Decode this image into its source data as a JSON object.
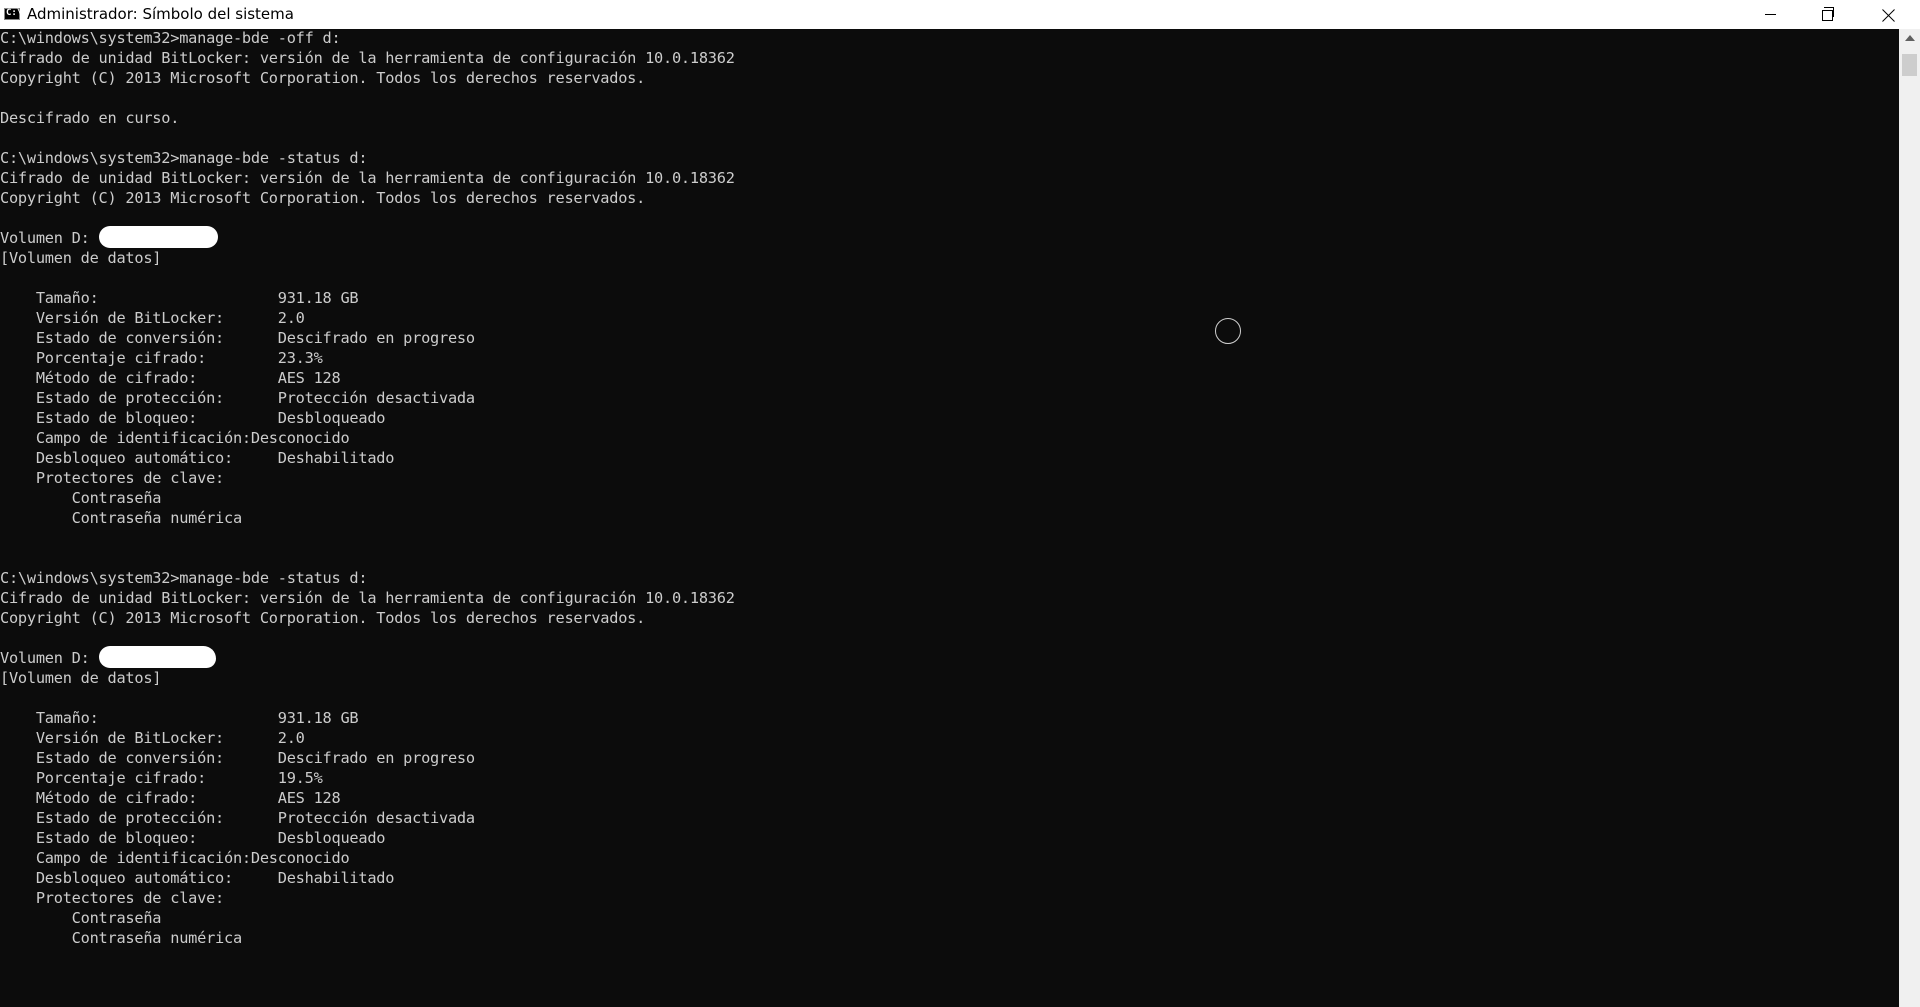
{
  "window": {
    "title": "Administrador: Símbolo del sistema",
    "icon": "cmd-icon",
    "icon_text": "C:\\"
  },
  "console_lines": [
    "C:\\windows\\system32>manage-bde -off d:",
    "Cifrado de unidad BitLocker: versión de la herramienta de configuración 10.0.18362",
    "Copyright (C) 2013 Microsoft Corporation. Todos los derechos reservados.",
    "",
    "Descifrado en curso.",
    "",
    "C:\\windows\\system32>manage-bde -status d:",
    "Cifrado de unidad BitLocker: versión de la herramienta de configuración 10.0.18362",
    "Copyright (C) 2013 Microsoft Corporation. Todos los derechos reservados.",
    "",
    "Volumen D: ",
    "[Volumen de datos]",
    "",
    "    Tamaño:                    931.18 GB",
    "    Versión de BitLocker:      2.0",
    "    Estado de conversión:      Descifrado en progreso",
    "    Porcentaje cifrado:        23.3%",
    "    Método de cifrado:         AES 128",
    "    Estado de protección:      Protección desactivada",
    "    Estado de bloqueo:         Desbloqueado",
    "    Campo de identificación:Desconocido",
    "    Desbloqueo automático:     Deshabilitado",
    "    Protectores de clave:",
    "        Contraseña",
    "        Contraseña numérica",
    "",
    "",
    "C:\\windows\\system32>manage-bde -status d:",
    "Cifrado de unidad BitLocker: versión de la herramienta de configuración 10.0.18362",
    "Copyright (C) 2013 Microsoft Corporation. Todos los derechos reservados.",
    "",
    "Volumen D: ",
    "[Volumen de datos]",
    "",
    "    Tamaño:                    931.18 GB",
    "    Versión de BitLocker:      2.0",
    "    Estado de conversión:      Descifrado en progreso",
    "    Porcentaje cifrado:        19.5%",
    "    Método de cifrado:         AES 128",
    "    Estado de protección:      Protección desactivada",
    "    Estado de bloqueo:         Desbloqueado",
    "    Campo de identificación:Desconocido",
    "    Desbloqueo automático:     Deshabilitado",
    "    Protectores de clave:",
    "        Contraseña",
    "        Contraseña numérica"
  ]
}
